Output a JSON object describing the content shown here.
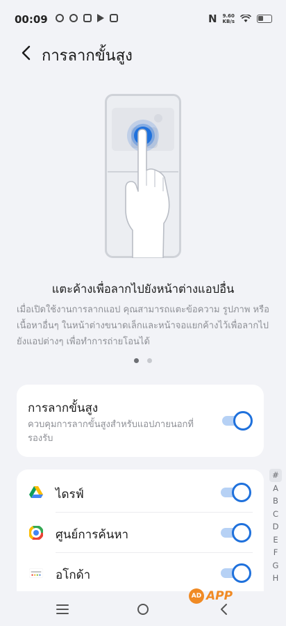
{
  "status_bar": {
    "time": "00:09",
    "net_speed_value": "9.60",
    "net_speed_unit": "KB/s",
    "nfc_label": "N"
  },
  "header": {
    "title": "การลากขั้นสูง",
    "back_icon": "chevron-left-icon"
  },
  "intro": {
    "title": "แตะค้างเพื่อลากไปยังหน้าต่างแอปอื่น",
    "description": "เมื่อเปิดใช้งานการลากแอป คุณสามารถแตะข้อความ รูปภาพ หรือเนื้อหาอื่นๆ ในหน้าต่างขนาดเล็กและหน้าจอแยกค้างไว้เพื่อลากไปยังแอปต่างๆ เพื่อทำการถ่ายโอนได้",
    "page_dots": 2,
    "active_dot": 1
  },
  "main_setting": {
    "label": "การลากขั้นสูง",
    "description": "ควบคุมการลากขั้นสูงสำหรับแอปภายนอกที่รองรับ",
    "enabled": true
  },
  "apps": [
    {
      "label": "ไดรฟ์",
      "icon": "google-drive-icon",
      "enabled": true
    },
    {
      "label": "ศูนย์การค้นหา",
      "icon": "search-center-icon",
      "enabled": true
    },
    {
      "label": "อโกด้า",
      "icon": "agoda-icon",
      "enabled": true
    }
  ],
  "index_bar": [
    "#",
    "A",
    "B",
    "C",
    "D",
    "E",
    "F",
    "G",
    "H"
  ],
  "nav": {
    "menu_icon": "menu-icon",
    "home_icon": "home-circle-icon",
    "back_icon": "back-chevron-icon"
  },
  "watermark": {
    "badge": "AD",
    "text": "APP"
  },
  "colors": {
    "accent": "#1f71dc",
    "toggle_track": "#b6d1f5",
    "background": "#f2f3f7",
    "card": "#ffffff",
    "secondary_text": "#8d8f95"
  }
}
